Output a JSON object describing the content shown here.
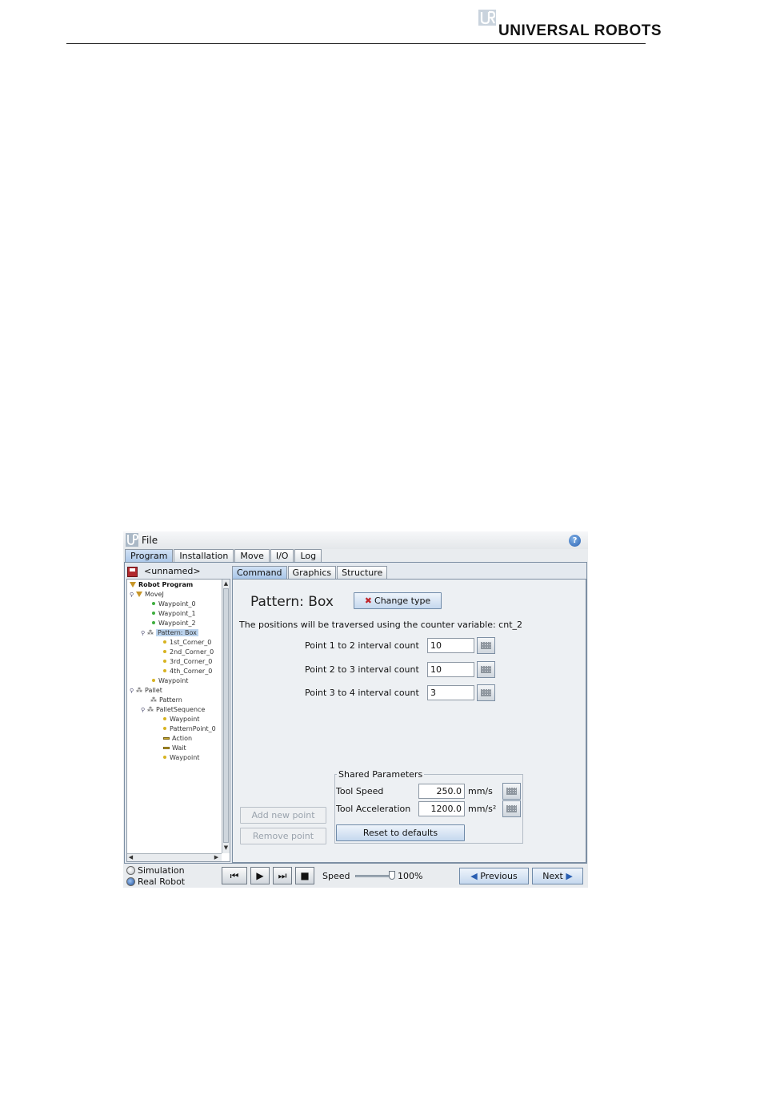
{
  "document": {
    "brand": "UNIVERSAL ROBOTS"
  },
  "app": {
    "menu": {
      "file": "File"
    },
    "main_tabs": [
      "Program",
      "Installation",
      "Move",
      "I/O",
      "Log"
    ],
    "active_main_tab": "Program",
    "program_name": "<unnamed>",
    "tree": [
      {
        "label": "Robot Program",
        "icon": "triangle-icon",
        "bold": true
      },
      {
        "label": "MoveJ",
        "icon": "triangle-icon"
      },
      {
        "label": "Waypoint_0",
        "icon": "green-dot-icon"
      },
      {
        "label": "Waypoint_1",
        "icon": "green-dot-icon"
      },
      {
        "label": "Waypoint_2",
        "icon": "green-dot-icon"
      },
      {
        "label": "Pattern: Box",
        "icon": "pattern-icon",
        "selected": true
      },
      {
        "label": "1st_Corner_0",
        "icon": "yellow-dot-icon"
      },
      {
        "label": "2nd_Corner_0",
        "icon": "yellow-dot-icon"
      },
      {
        "label": "3rd_Corner_0",
        "icon": "yellow-dot-icon"
      },
      {
        "label": "4th_Corner_0",
        "icon": "yellow-dot-icon"
      },
      {
        "label": "Waypoint",
        "icon": "yellow-dot-icon"
      },
      {
        "label": "Pallet",
        "icon": "pattern-icon"
      },
      {
        "label": "Pattern",
        "icon": "pattern-icon"
      },
      {
        "label": "PalletSequence",
        "icon": "pattern-icon"
      },
      {
        "label": "Waypoint",
        "icon": "yellow-dot-icon"
      },
      {
        "label": "PatternPoint_0",
        "icon": "yellow-dot-icon"
      },
      {
        "label": "Action",
        "icon": "bar-icon"
      },
      {
        "label": "Wait",
        "icon": "hourglass-icon"
      },
      {
        "label": "Waypoint",
        "icon": "yellow-dot-icon"
      }
    ],
    "sub_tabs": [
      "Command",
      "Graphics",
      "Structure"
    ],
    "active_sub_tab": "Command",
    "command": {
      "title": "Pattern: Box",
      "change_type": "Change type",
      "description": "The positions will be traversed using the counter variable: cnt_2",
      "intervals": [
        {
          "label": "Point 1 to 2 interval count",
          "value": "10"
        },
        {
          "label": "Point 2 to 3 interval count",
          "value": "10"
        },
        {
          "label": "Point 3 to 4 interval count",
          "value": "3"
        }
      ],
      "add_point": "Add new point",
      "remove_point": "Remove point",
      "shared": {
        "title": "Shared Parameters",
        "tool_speed_label": "Tool Speed",
        "tool_speed_value": "250.0",
        "tool_speed_unit": "mm/s",
        "tool_accel_label": "Tool Acceleration",
        "tool_accel_value": "1200.0",
        "tool_accel_unit": "mm/s²",
        "reset": "Reset to defaults"
      }
    },
    "bottom": {
      "simulation": "Simulation",
      "real_robot": "Real Robot",
      "selected_mode": "Real Robot",
      "speed_label": "Speed",
      "speed_value": "100%",
      "speed_fraction": 1.0,
      "previous": "Previous",
      "next": "Next"
    },
    "colors": {
      "accent": "#a9c6e8",
      "brand_red": "#c1272d"
    }
  }
}
